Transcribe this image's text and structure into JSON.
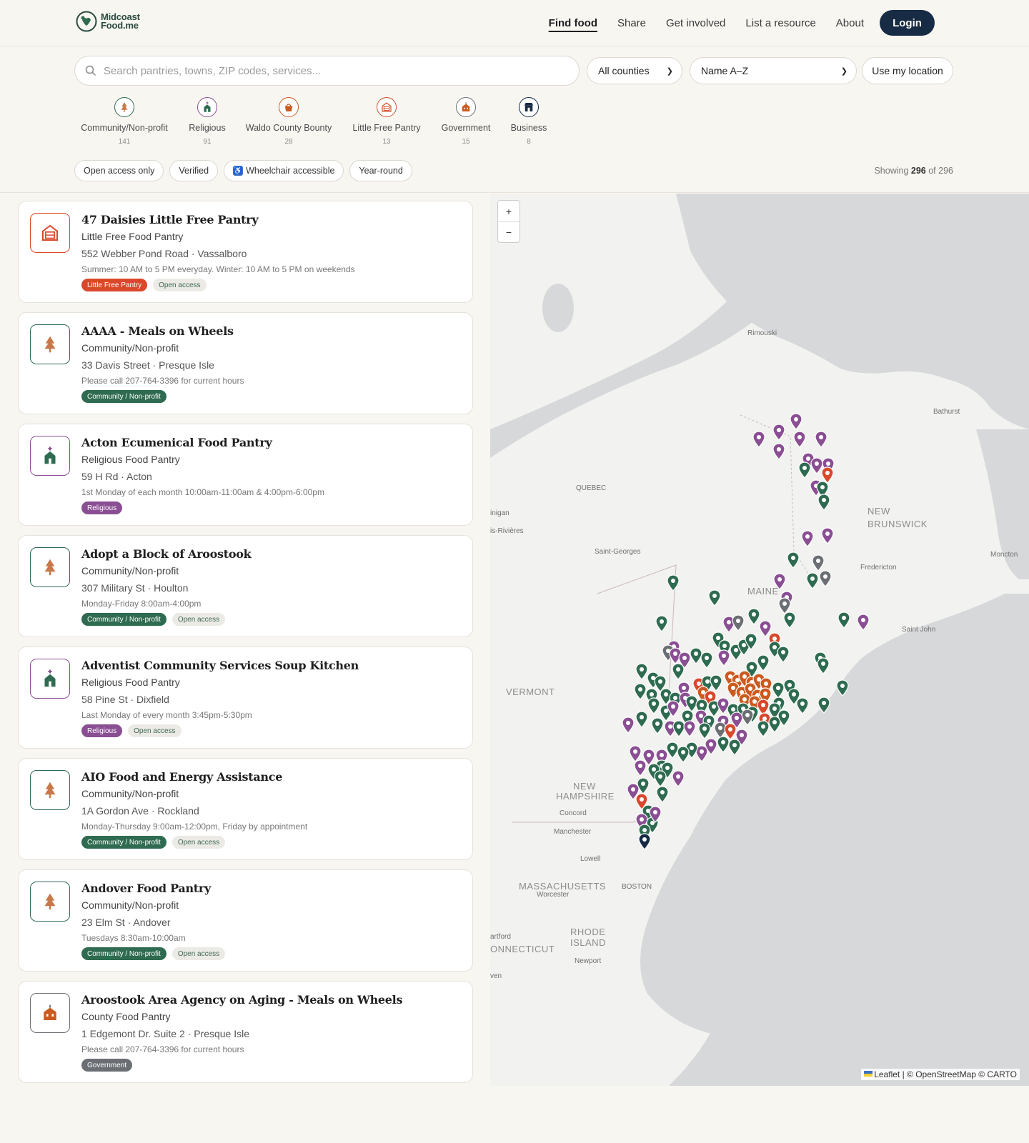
{
  "header": {
    "logo_line1": "Midcoast",
    "logo_line2": "Food.me",
    "nav": [
      "Find food",
      "Share",
      "Get involved",
      "List a resource",
      "About"
    ],
    "login": "Login"
  },
  "search": {
    "placeholder": "Search pantries, towns, ZIP codes, services..."
  },
  "county_select": "All counties",
  "sort_select": "Name A–Z",
  "use_location": "Use my location",
  "categories": [
    {
      "label": "Community/Non-profit",
      "count": "141",
      "color": "#2e6b50",
      "icon": "tree-icon"
    },
    {
      "label": "Religious",
      "count": "91",
      "color": "#8a4e93",
      "icon": "church-icon"
    },
    {
      "label": "Waldo County Bounty",
      "count": "28",
      "color": "#cc5a1e",
      "icon": "basket-icon"
    },
    {
      "label": "Little Free Pantry",
      "count": "13",
      "color": "#d4502f",
      "icon": "pantry-icon"
    },
    {
      "label": "Government",
      "count": "15",
      "color": "#6b6f74",
      "icon": "building-icon"
    },
    {
      "label": "Business",
      "count": "8",
      "color": "#172b44",
      "icon": "store-icon"
    }
  ],
  "chips": [
    "Open access only",
    "Verified",
    "Wheelchair accessible",
    "Year-round"
  ],
  "showing": {
    "prefix": "Showing",
    "count": "296",
    "of": "of 296"
  },
  "listings": [
    {
      "name": "47 Daisies Little Free Pantry",
      "type": "Little Free Food Pantry",
      "address": "552 Webber Pond Road · Vassalboro",
      "hours": "Summer: 10 AM to 5 PM everyday. Winter: 10 AM to 5 PM on weekends",
      "tag": "Little Free Pantry",
      "tag_color": "#d9482b",
      "open": "Open access",
      "icon": "pantry-icon",
      "border": "#d9482b"
    },
    {
      "name": "AAAA - Meals on Wheels",
      "type": "Community/Non-profit",
      "address": "33 Davis Street · Presque Isle",
      "hours": "Please call 207-764-3396 for current hours",
      "tag": "Community / Non-profit",
      "tag_color": "#2e6b50",
      "open": "",
      "icon": "tree-icon",
      "border": "#2e6b50"
    },
    {
      "name": "Acton Ecumenical Food Pantry",
      "type": "Religious Food Pantry",
      "address": "59 H Rd · Acton",
      "hours": "1st Monday of each month 10:00am-11:00am & 4:00pm-6:00pm",
      "tag": "Religious",
      "tag_color": "#8a4e93",
      "open": "",
      "icon": "church-icon",
      "border": "#8a4e93"
    },
    {
      "name": "Adopt a Block of Aroostook",
      "type": "Community/Non-profit",
      "address": "307 Military St · Houlton",
      "hours": "Monday-Friday 8:00am-4:00pm",
      "tag": "Community / Non-profit",
      "tag_color": "#2e6b50",
      "open": "Open access",
      "icon": "tree-icon",
      "border": "#2e6b50"
    },
    {
      "name": "Adventist Community Services Soup Kitchen",
      "type": "Religious Food Pantry",
      "address": "58 Pine St · Dixfield",
      "hours": "Last Monday of every month 3:45pm-5:30pm",
      "tag": "Religious",
      "tag_color": "#8a4e93",
      "open": "Open access",
      "icon": "church-icon",
      "border": "#8a4e93"
    },
    {
      "name": "AIO Food and Energy Assistance",
      "type": "Community/Non-profit",
      "address": "1A Gordon Ave · Rockland",
      "hours": "Monday-Thursday 9:00am-12:00pm, Friday by appointment",
      "tag": "Community / Non-profit",
      "tag_color": "#2e6b50",
      "open": "Open access",
      "icon": "tree-icon",
      "border": "#2e6b50"
    },
    {
      "name": "Andover Food Pantry",
      "type": "Community/Non-profit",
      "address": "23 Elm St · Andover",
      "hours": "Tuesdays 8:30am-10:00am",
      "tag": "Community / Non-profit",
      "tag_color": "#2e6b50",
      "open": "Open access",
      "icon": "tree-icon",
      "border": "#2e6b50"
    },
    {
      "name": "Aroostook Area Agency on Aging - Meals on Wheels",
      "type": "County Food Pantry",
      "address": "1 Edgemont Dr. Suite 2 · Presque Isle",
      "hours": "Please call 207-764-3396 for current hours",
      "tag": "Government",
      "tag_color": "#6b6f74",
      "open": "",
      "icon": "building-icon",
      "border": "#6b6f74"
    }
  ],
  "map": {
    "zoom_in": "+",
    "zoom_out": "−",
    "attribution": "Leaflet | © OpenStreetMap © CARTO",
    "labels": [
      {
        "text": "Rimouski",
        "cls": "city"
      },
      {
        "text": "Bathurst",
        "cls": "city"
      },
      {
        "text": "QUEBEC",
        "cls": "city"
      },
      {
        "text": "NEW",
        "cls": "state"
      },
      {
        "text": "BRUNSWICK",
        "cls": "state"
      },
      {
        "text": "inigan",
        "cls": "city"
      },
      {
        "text": "is-Rivières",
        "cls": "city"
      },
      {
        "text": "Saint-Georges",
        "cls": "city"
      },
      {
        "text": "Fredericton",
        "cls": "city"
      },
      {
        "text": "Moncton",
        "cls": "city"
      },
      {
        "text": "MAINE",
        "cls": "state"
      },
      {
        "text": "Saint John",
        "cls": "city"
      },
      {
        "text": "VERMONT",
        "cls": "state"
      },
      {
        "text": "NEW",
        "cls": "state"
      },
      {
        "text": "HAMPSHIRE",
        "cls": "state"
      },
      {
        "text": "Concord",
        "cls": "city"
      },
      {
        "text": "Manchester",
        "cls": "city"
      },
      {
        "text": "Lowell",
        "cls": "city"
      },
      {
        "text": "MASSACHUSETTS",
        "cls": "state"
      },
      {
        "text": "Worcester",
        "cls": "city"
      },
      {
        "text": "BOSTON",
        "cls": "city"
      },
      {
        "text": "RHODE",
        "cls": "state"
      },
      {
        "text": "ISLAND",
        "cls": "state"
      },
      {
        "text": "artford",
        "cls": "city"
      },
      {
        "text": "ONNECTICUT",
        "cls": "state"
      },
      {
        "text": "Newport",
        "cls": "city"
      },
      {
        "text": "ven",
        "cls": "city"
      }
    ]
  }
}
